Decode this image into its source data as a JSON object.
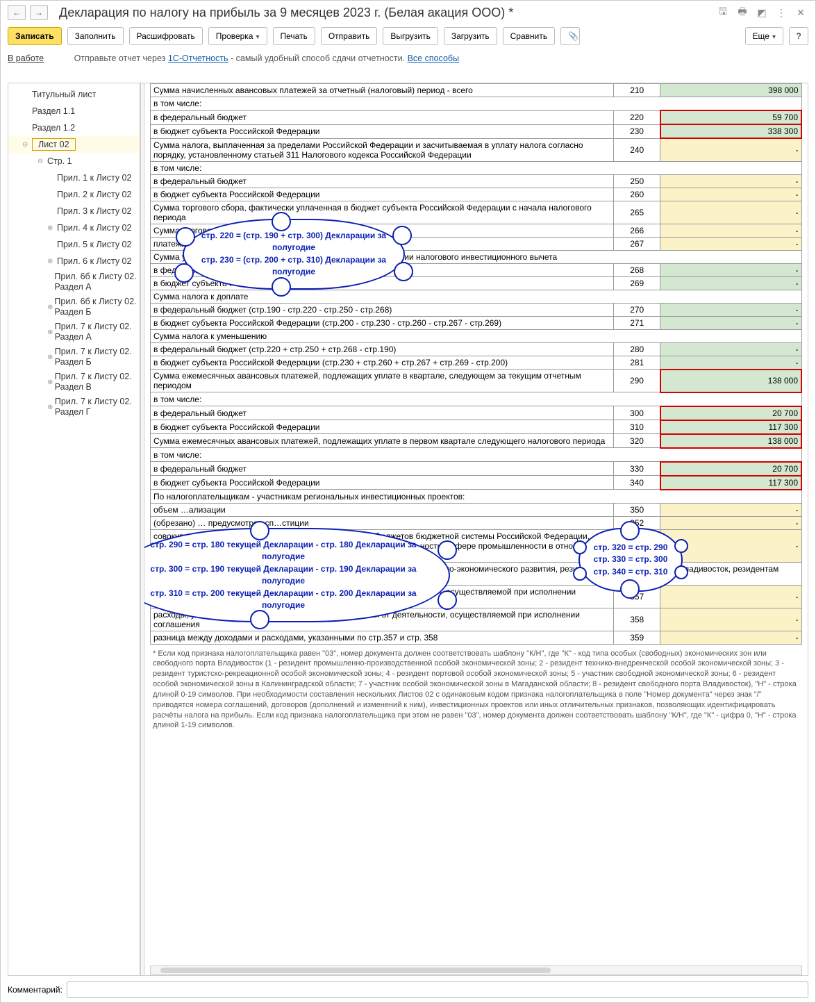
{
  "header": {
    "title": "Декларация по налогу на прибыль за 9 месяцев 2023 г. (Белая акация ООО) *"
  },
  "toolbar": {
    "record": "Записать",
    "fill": "Заполнить",
    "decode": "Расшифровать",
    "check": "Проверка",
    "print": "Печать",
    "send": "Отправить",
    "upload": "Выгрузить",
    "load": "Загрузить",
    "compare": "Сравнить",
    "more": "Еще"
  },
  "info": {
    "inwork": "В работе",
    "prefix": "Отправьте отчет через ",
    "link1": "1С-Отчетность",
    "middle": " - самый удобный способ сдачи отчетности. ",
    "link2": "Все способы"
  },
  "tree": {
    "items": [
      {
        "label": "Титульный лист",
        "lv": 1
      },
      {
        "label": "Раздел 1.1",
        "lv": 1
      },
      {
        "label": "Раздел 1.2",
        "lv": 1
      },
      {
        "label": "Лист 02",
        "lv": 1,
        "sel": true,
        "tgl": "⊖"
      },
      {
        "label": "Стр. 1",
        "lv": 2,
        "tgl": "⊖"
      },
      {
        "label": "Прил. 1 к Листу 02",
        "lv": 3
      },
      {
        "label": "Прил. 2 к Листу 02",
        "lv": 3
      },
      {
        "label": "Прил. 3 к Листу 02",
        "lv": 3
      },
      {
        "label": "Прил. 4 к Листу 02",
        "lv": 3,
        "tgl": "⊕"
      },
      {
        "label": "Прил. 5 к Листу 02",
        "lv": 3
      },
      {
        "label": "Прил. 6 к Листу 02",
        "lv": 3,
        "tgl": "⊕"
      },
      {
        "label": "Прил. 6б к Листу 02. Раздел А",
        "lv": 3
      },
      {
        "label": "Прил. 6б к Листу 02. Раздел Б",
        "lv": 3,
        "tgl": "⊕"
      },
      {
        "label": "Прил. 7 к Листу 02. Раздел А",
        "lv": 3,
        "tgl": "⊕"
      },
      {
        "label": "Прил. 7 к Листу 02. Раздел Б",
        "lv": 3,
        "tgl": "⊕"
      },
      {
        "label": "Прил. 7 к Листу 02. Раздел В",
        "lv": 3,
        "tgl": "⊕"
      },
      {
        "label": "Прил. 7 к Листу 02. Раздел Г",
        "lv": 3,
        "tgl": "⊕"
      }
    ]
  },
  "rows": [
    {
      "desc": "Сумма начисленных авансовых платежей за отчетный (налоговый) период - всего",
      "code": "210",
      "val": "398 000",
      "bg": "green"
    },
    {
      "desc": "в том числе:",
      "code": "",
      "val": "",
      "noborder": true
    },
    {
      "desc": "в федеральный бюджет",
      "indent": true,
      "code": "220",
      "val": "59 700",
      "bg": "green",
      "red": true
    },
    {
      "desc": "в бюджет субъекта Российской Федерации",
      "indent": true,
      "code": "230",
      "val": "338 300",
      "bg": "green",
      "red": true
    },
    {
      "desc": "Сумма налога, выплаченная за пределами Российской Федерации и засчитываемая в уплату налога согласно порядку, установленному статьей 311 Налогового кодекса Российской Федерации",
      "code": "240",
      "val": "-",
      "bg": "yellow"
    },
    {
      "desc": "в том числе:",
      "code": "",
      "val": "",
      "noborder": true
    },
    {
      "desc": "в федеральный бюджет",
      "indent": true,
      "code": "250",
      "val": "-",
      "bg": "yellow"
    },
    {
      "desc": "в бюджет субъекта Российской Федерации",
      "indent": true,
      "code": "260",
      "val": "-",
      "bg": "yellow"
    },
    {
      "desc": "Сумма торгового сбора, фактически уплаченная в бюджет субъекта Российской Федерации с начала налогового периода",
      "code": "265",
      "val": "-",
      "bg": "yellow"
    },
    {
      "desc": "Сумма торгового сбора … платежи в бюджет",
      "code": "266",
      "val": "-",
      "bg": "yellow"
    },
    {
      "desc": "платежи (налоговый) период",
      "code": "267",
      "val": "-",
      "bg": "yellow"
    },
    {
      "desc": "Сумма уменьшения авансовых платежей (налога) при применении налогового инвестиционного вычета",
      "code": "",
      "val": "",
      "noborder": true
    },
    {
      "desc": "в федеральный бюджет",
      "indent": true,
      "code": "268",
      "val": "-",
      "bg": "green"
    },
    {
      "desc": "в бюджет субъекта Российской Федерации",
      "indent": true,
      "code": "269",
      "val": "-",
      "bg": "green"
    },
    {
      "desc": "Сумма налога к доплате",
      "code": "",
      "val": "",
      "noborder": true
    },
    {
      "desc": "в федеральный бюджет (стр.190 - стр.220 - стр.250 - стр.268)",
      "indent": true,
      "code": "270",
      "val": "-",
      "bg": "green"
    },
    {
      "desc": "в бюджет субъекта Российской Федерации (стр.200 - стр.230 - стр.260 - стр.267 - стр.269)",
      "indent": true,
      "code": "271",
      "val": "-",
      "bg": "green"
    },
    {
      "desc": "Сумма налога к уменьшению",
      "code": "",
      "val": "",
      "noborder": true
    },
    {
      "desc": "в федеральный бюджет (стр.220 + стр.250 + стр.268 - стр.190)",
      "indent": true,
      "code": "280",
      "val": "-",
      "bg": "green"
    },
    {
      "desc": "в бюджет субъекта Российской Федерации (стр.230 + стр.260 + стр.267 + стр.269 - стр.200)",
      "indent": true,
      "code": "281",
      "val": "-",
      "bg": "green"
    },
    {
      "desc": "Сумма ежемесячных авансовых платежей, подлежащих уплате в квартале, следующем за текущим отчетным периодом",
      "code": "290",
      "val": "138 000",
      "bg": "green",
      "red": true
    },
    {
      "desc": "в том числе:",
      "code": "",
      "val": "",
      "noborder": true
    },
    {
      "desc": "в федеральный бюджет",
      "indent": true,
      "code": "300",
      "val": "20 700",
      "bg": "green",
      "red": true
    },
    {
      "desc": "в бюджет субъекта Российской Федерации",
      "indent": true,
      "code": "310",
      "val": "117 300",
      "bg": "green",
      "red": true
    },
    {
      "desc": "Сумма ежемесячных авансовых платежей, подлежащих уплате в первом квартале следующего налогового периода",
      "code": "320",
      "val": "138 000",
      "bg": "green",
      "red": true
    },
    {
      "desc": "в том числе:",
      "code": "",
      "val": "",
      "noborder": true
    },
    {
      "desc": "в федеральный бюджет",
      "indent": true,
      "code": "330",
      "val": "20 700",
      "bg": "green",
      "red": true
    },
    {
      "desc": "в бюджет субъекта Российской Федерации",
      "indent": true,
      "code": "340",
      "val": "117 300",
      "bg": "green",
      "red": true
    },
    {
      "desc": "По налогоплательщикам - участникам региональных инвестиционных проектов:",
      "code": "",
      "val": "",
      "noborder": true
    },
    {
      "desc": "объем …ализации",
      "indent": true,
      "code": "350",
      "val": "-",
      "bg": "yellow"
    },
    {
      "desc": "(обрезано) … предусмотрен сп…стиции",
      "indent": true,
      "code": "352",
      "val": "-",
      "bg": "yellow"
    },
    {
      "desc": "совокупный объем расходов и недополученных доходов бюджетов бюджетной системы Российской Федерации, образующихся в связи с применением мер стимулирования деятельности в сфере промышленности в отношении инвестиционного проекта",
      "indent": true,
      "code": "353",
      "val": "-",
      "bg": "yellow"
    },
    {
      "desc": "По налогоплательщикам - резидентам территории опережающего социально-экономического развития, резидентам свободного порта Владивосток, резидентам Арктической зоны Российской Федерации:",
      "code": "",
      "val": "",
      "noborder": true
    },
    {
      "desc": "доходы, учитываемые при определении первой прибыли от деятельности, осуществляемой при исполнении соглашения",
      "indent": true,
      "code": "357",
      "val": "-",
      "bg": "yellow"
    },
    {
      "desc": "расходы, учитываемые при определении первой прибыли от деятельности, осуществляемой при исполнении соглашения",
      "indent": true,
      "code": "358",
      "val": "-",
      "bg": "yellow"
    },
    {
      "desc": "разница между доходами и расходами, указанными по стр.357 и стр. 358",
      "indent": true,
      "code": "359",
      "val": "-",
      "bg": "yellow"
    }
  ],
  "footnote": "* Если код признака налогоплательщика равен \"03\", номер документа должен соответствовать шаблону \"К/Н\", где \"К\" - код типа особых (свободных) экономических зон или свободного порта Владивосток (1 - резидент промышленно-производственной особой экономической зоны; 2 - резидент технико-внедренческой особой экономической зоны; 3 - резидент туристско-рекреационной особой экономической зоны; 4 - резидент портовой особой экономической зоны; 5 - участник свободной экономической зоны; 6 - резидент особой экономической зоны в Калининградской области; 7 - участник особой экономической зоны в Магаданской области; 8 - резидент свободного порта Владивосток), \"Н\" - строка длиной 0-19 символов.\n  При необходимости составления нескольких Листов 02 с одинаковым кодом признака налогоплательщика в поле \"Номер документа\" через знак \"/\" приводятся номера соглашений, договоров (дополнений и изменений к ним), инвестиционных проектов или иных отличительных признаков, позволяющих идентифицировать расчёты налога на прибыль. Если код признака налогоплательщика при этом не равен \"03\", номер документа должен соответствовать шаблону \"К/Н\", где \"К\" - цифра 0, \"Н\" - строка длиной 1-19 символов.",
  "clouds": {
    "c1_l1": "стр. 220 = (стр. 190 + стр. 300) Декларации за полугодие",
    "c1_l2": "стр. 230 = (стр. 200 + стр. 310) Декларации за полугодие",
    "c2_l1": "стр. 290 = стр. 180 текущей Декларации - стр. 180 Декларации за полугодие",
    "c2_l2": "стр. 300 = стр. 190 текущей Декларации - стр. 190 Декларации за полугодие",
    "c2_l3": "стр. 310 = стр. 200 текущей Декларации - стр. 200 Декларации за полугодие",
    "c3_l1": "стр. 320 = стр. 290",
    "c3_l2": "стр. 330 = стр. 300",
    "c3_l3": "стр. 340 = стр. 310"
  },
  "footer": {
    "label": "Комментарий:"
  }
}
